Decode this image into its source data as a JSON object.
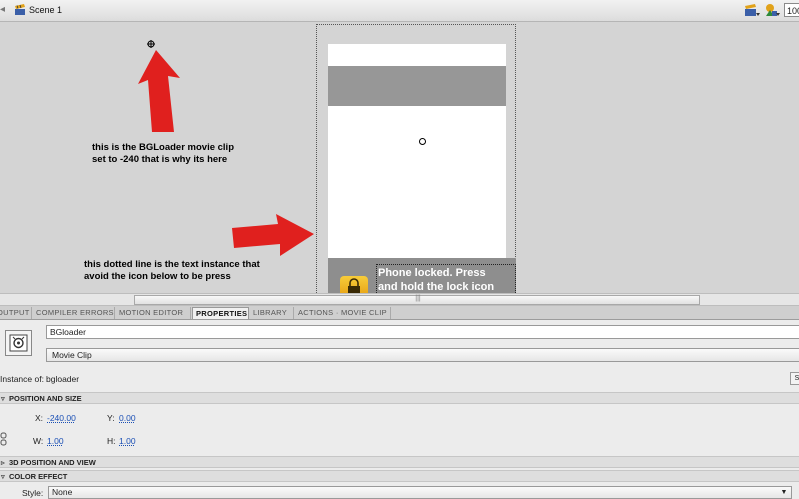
{
  "topbar": {
    "scene_label": "Scene 1",
    "zoom_value": "100"
  },
  "stage": {
    "annotation_bgloader_line1": "this is the BGLoader movie clip",
    "annotation_bgloader_line2": "set to -240 that is why its here",
    "annotation_dotted_line1": "this dotted line is the text instance that",
    "annotation_dotted_line2": "avoid the icon below to be press",
    "lock_text_line1": "Phone locked. Press",
    "lock_text_line2": "and hold the lock icon",
    "colors": {
      "arrow": "#e0201e",
      "lock_band": "#8e8e8e",
      "header_band": "#979797"
    },
    "icons": [
      "crosshair-icon",
      "lock-icon",
      "registration-point-icon"
    ]
  },
  "tabs": [
    {
      "label": "OUTPUT"
    },
    {
      "label": "COMPILER ERRORS"
    },
    {
      "label": "MOTION EDITOR"
    },
    {
      "label": "PROPERTIES",
      "active": true
    },
    {
      "label": "LIBRARY"
    },
    {
      "label": "ACTIONS · MOVIE CLIP"
    }
  ],
  "properties": {
    "instance_name": "BGloader",
    "symbol_type": "Movie Clip",
    "instance_of_label": "Instance of:",
    "instance_of_value": "bgloader",
    "swap_label": "S",
    "sections": {
      "position_size": "POSITION AND SIZE",
      "position_3d": "3D POSITION AND VIEW",
      "color_effect": "COLOR EFFECT"
    },
    "x_label": "X:",
    "x_value": "-240.00",
    "y_label": "Y:",
    "y_value": "0.00",
    "w_label": "W:",
    "w_value": "1.00",
    "h_label": "H:",
    "h_value": "1.00",
    "style_label": "Style:",
    "style_value": "None"
  }
}
